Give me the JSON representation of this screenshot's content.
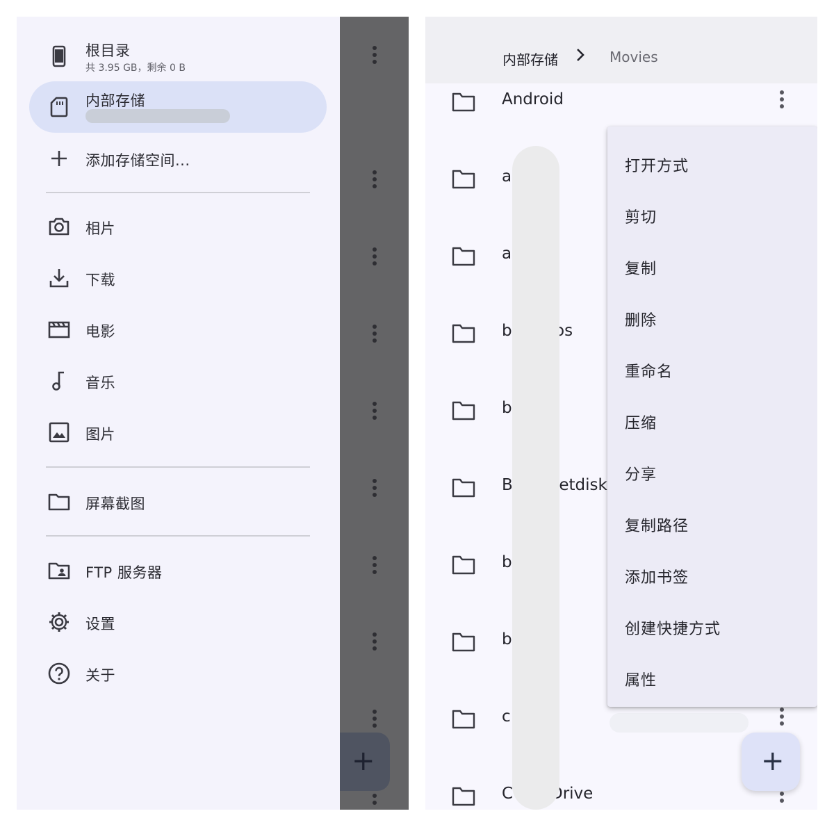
{
  "drawer": {
    "root": {
      "label": "根目录",
      "subtitle": "共 3.95 GB，剩余 0 B",
      "icon": "phone-icon"
    },
    "internal": {
      "label": "内部存储",
      "icon": "sd-card-icon"
    },
    "add_storage": {
      "label": "添加存储空间...",
      "icon": "plus-icon"
    },
    "libraries": [
      {
        "label": "相片",
        "icon": "camera-icon"
      },
      {
        "label": "下载",
        "icon": "download-icon"
      },
      {
        "label": "电影",
        "icon": "movie-icon"
      },
      {
        "label": "音乐",
        "icon": "music-icon"
      },
      {
        "label": "图片",
        "icon": "image-icon"
      }
    ],
    "bookmarks": [
      {
        "label": "屏幕截图",
        "icon": "folder-icon"
      }
    ],
    "misc": [
      {
        "label": "FTP 服务器",
        "icon": "ftp-server-icon"
      },
      {
        "label": "设置",
        "icon": "gear-icon"
      },
      {
        "label": "关于",
        "icon": "help-icon"
      }
    ]
  },
  "scrim_fab": {
    "label": "+"
  },
  "breadcrumb": {
    "items": [
      "内部存储",
      "Movies"
    ],
    "separator_icon": "chevron-right-icon"
  },
  "files": [
    {
      "name": "Android"
    },
    {
      "name": "a"
    },
    {
      "name": "a"
    },
    {
      "name": "b",
      "tail": "os"
    },
    {
      "name": "b"
    },
    {
      "name": "B",
      "tail": "letdisk"
    },
    {
      "name": "b"
    },
    {
      "name": "b"
    },
    {
      "name": "c"
    },
    {
      "name": "C",
      "tail": "Drive"
    }
  ],
  "context_menu": {
    "items": [
      "打开方式",
      "剪切",
      "复制",
      "删除",
      "重命名",
      "压缩",
      "分享",
      "复制路径",
      "添加书签",
      "创建快捷方式",
      "属性"
    ]
  },
  "fab": {
    "label": "+",
    "icon": "plus-icon"
  },
  "colors": {
    "drawer_bg": "#f4f3fc",
    "selected_bg": "#dbe1f7",
    "scrim": "#646466",
    "menu_bg": "#ecebf6",
    "fab_bg": "#dee2f8"
  }
}
